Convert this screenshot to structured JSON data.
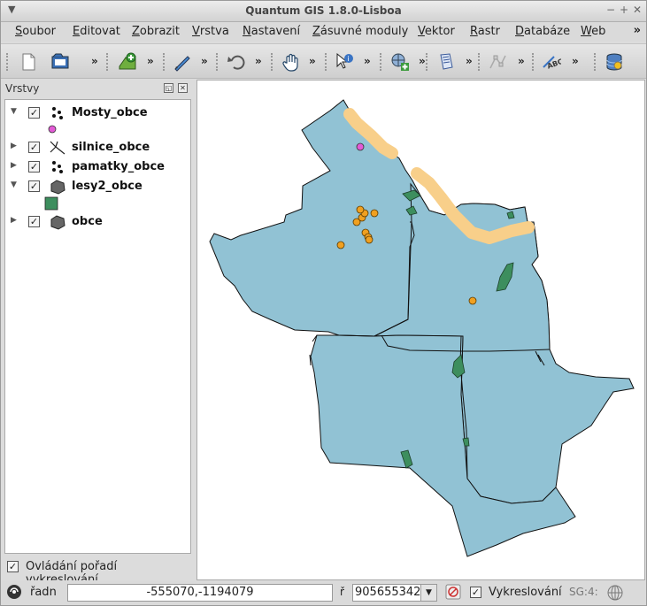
{
  "window": {
    "title": "Quantum GIS 1.8.0-Lisboa"
  },
  "menubar": {
    "items": [
      {
        "label": "Soubor"
      },
      {
        "label": "Editovat"
      },
      {
        "label": "Zobrazit"
      },
      {
        "label": "Vrstva"
      },
      {
        "label": "Nastavení"
      },
      {
        "label": "Zásuvné moduly"
      },
      {
        "label": "Vektor"
      },
      {
        "label": "Rastr"
      },
      {
        "label": "Databáze"
      },
      {
        "label": "Web"
      }
    ],
    "overflow": "»"
  },
  "toolbar": {
    "overflow": "»"
  },
  "layers_panel": {
    "title": "Vrstvy",
    "layers": [
      {
        "name": "Mosty_obce",
        "expanded": true,
        "checked": true,
        "symbol": "points-icon",
        "legend_color": "#e35ad6"
      },
      {
        "name": "silnice_obce",
        "expanded": false,
        "checked": true,
        "symbol": "lines-icon"
      },
      {
        "name": "pamatky_obce",
        "expanded": false,
        "checked": true,
        "symbol": "points-icon"
      },
      {
        "name": "lesy2_obce",
        "expanded": true,
        "checked": true,
        "symbol": "polygon-icon",
        "legend_color": "#3d8e5e"
      },
      {
        "name": "obce",
        "expanded": false,
        "checked": true,
        "symbol": "polygon-icon"
      }
    ],
    "render_order_label": "Ovládání pořadí vykreslování",
    "render_order_checked": true
  },
  "colors": {
    "municipality_fill": "#91c2d4",
    "forest_fill": "#3d8e5e",
    "bridge_color": "#e35ad6",
    "monument_color": "#f0a020",
    "road_color": "#f8cf8a"
  },
  "statusbar": {
    "coord_label": "řadn",
    "coordinates": "-555070,-1194079",
    "scale_label": "ř",
    "scale_value": "905655342",
    "render_label": "Vykreslování",
    "render_checked": true,
    "crs_label": "SG:4:"
  }
}
